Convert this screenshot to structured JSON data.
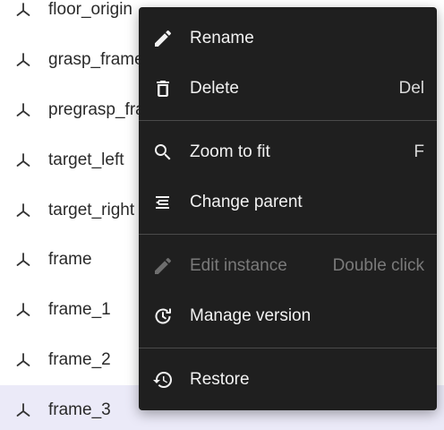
{
  "tree": {
    "items": [
      {
        "label": "floor_origin",
        "icon": "frame-axes-icon",
        "selected": false
      },
      {
        "label": "grasp_frame",
        "icon": "frame-axes-icon",
        "selected": false
      },
      {
        "label": "pregrasp_frame",
        "icon": "frame-axes-icon",
        "selected": false
      },
      {
        "label": "target_left",
        "icon": "frame-axes-icon",
        "selected": false
      },
      {
        "label": "target_right",
        "icon": "frame-axes-icon",
        "selected": false
      },
      {
        "label": "frame",
        "icon": "frame-axes-icon",
        "selected": false
      },
      {
        "label": "frame_1",
        "icon": "frame-axes-icon",
        "selected": false
      },
      {
        "label": "frame_2",
        "icon": "frame-axes-icon",
        "selected": false
      },
      {
        "label": "frame_3",
        "icon": "frame-axes-icon",
        "selected": true
      }
    ],
    "selected_color": "#ebeaf8"
  },
  "context_menu": {
    "background": "#1f1f1f",
    "rename": {
      "label": "Rename",
      "icon": "pencil-icon",
      "shortcut": ""
    },
    "delete": {
      "label": "Delete",
      "icon": "trash-icon",
      "shortcut": "Del"
    },
    "zoom_to_fit": {
      "label": "Zoom to fit",
      "icon": "search-icon",
      "shortcut": "F"
    },
    "change_parent": {
      "label": "Change parent",
      "icon": "change-parent-icon",
      "shortcut": ""
    },
    "edit_instance": {
      "label": "Edit instance",
      "icon": "pencil-icon",
      "shortcut": "Double click",
      "disabled": true
    },
    "manage_version": {
      "label": "Manage version",
      "icon": "version-refresh-icon",
      "shortcut": ""
    },
    "restore": {
      "label": "Restore",
      "icon": "history-icon",
      "shortcut": ""
    }
  }
}
